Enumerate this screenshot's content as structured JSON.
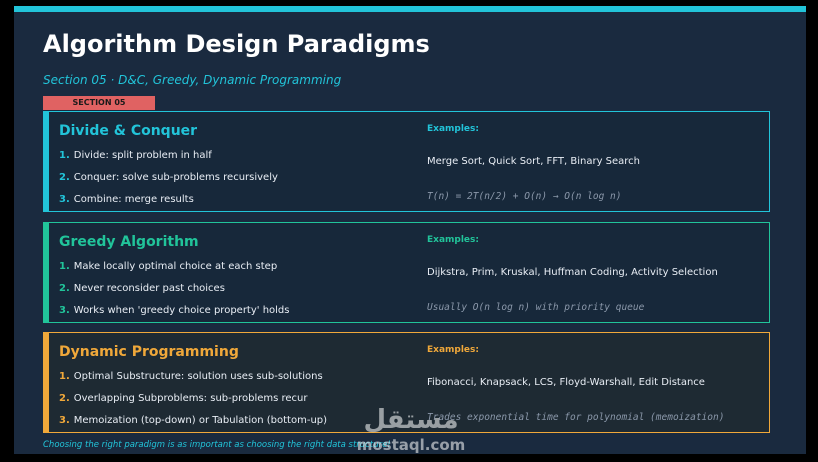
{
  "title": "Algorithm Design Paradigms",
  "subtitle": "Section 05 · D&C, Greedy, Dynamic Programming",
  "section_tag": "SECTION 05",
  "cards": [
    {
      "title": "Divide & Conquer",
      "accent": "#22c4d9",
      "steps": [
        {
          "num": "1.",
          "text": "Divide: split problem in half"
        },
        {
          "num": "2.",
          "text": "Conquer: solve sub-problems recursively"
        },
        {
          "num": "3.",
          "text": "Combine: merge results"
        }
      ],
      "examples_label": "Examples:",
      "examples": "Merge Sort, Quick Sort, FFT, Binary Search",
      "note": "T(n) = 2T(n/2) + O(n)  →  O(n log n)"
    },
    {
      "title": "Greedy Algorithm",
      "accent": "#21c49a",
      "steps": [
        {
          "num": "1.",
          "text": "Make locally optimal choice at each step"
        },
        {
          "num": "2.",
          "text": "Never reconsider past choices"
        },
        {
          "num": "3.",
          "text": "Works when 'greedy choice property' holds"
        }
      ],
      "examples_label": "Examples:",
      "examples": "Dijkstra, Prim, Kruskal, Huffman Coding, Activity Selection",
      "note": "Usually O(n log n) with priority queue"
    },
    {
      "title": "Dynamic Programming",
      "accent": "#f0a83a",
      "steps": [
        {
          "num": "1.",
          "text": "Optimal Substructure: solution uses sub-solutions"
        },
        {
          "num": "2.",
          "text": "Overlapping Subproblems: sub-problems recur"
        },
        {
          "num": "3.",
          "text": "Memoization (top-down) or Tabulation (bottom-up)"
        }
      ],
      "examples_label": "Examples:",
      "examples": "Fibonacci, Knapsack, LCS, Floyd-Warshall, Edit Distance",
      "note": "Trades exponential time for polynomial (memoization)"
    }
  ],
  "footer": "Choosing the right paradigm is as important as choosing the right data structure!",
  "watermark_text": "mostaql.com",
  "colors": {
    "background": "#1a2a3f",
    "accent_cyan": "#22c4d9",
    "accent_green": "#21c49a",
    "accent_orange": "#f0a83a",
    "tag_red": "#e06262"
  }
}
